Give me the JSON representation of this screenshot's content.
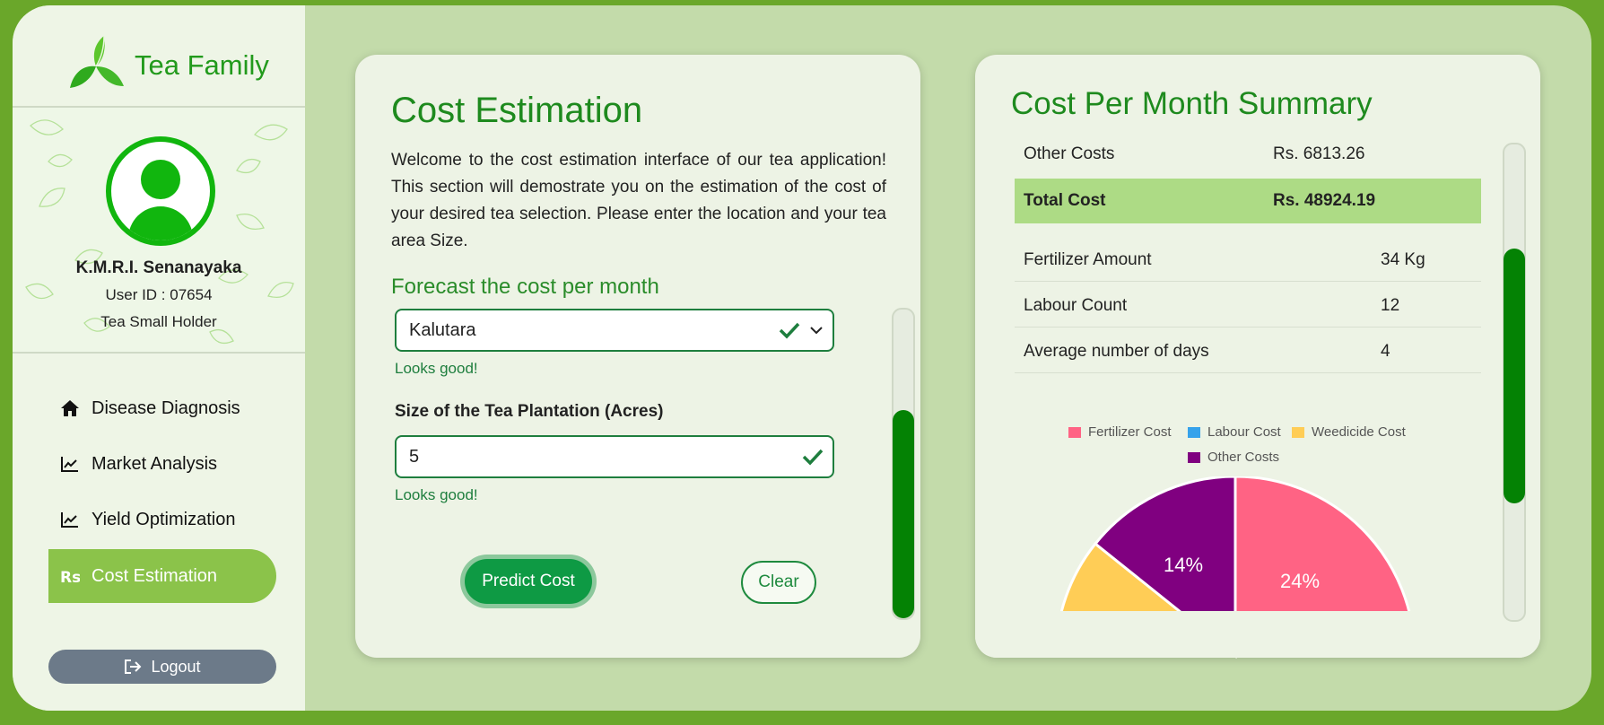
{
  "brand": {
    "name": "Tea Family"
  },
  "user": {
    "name": "K.M.R.I. Senanayaka",
    "id": "User ID : 07654",
    "role": "Tea Small Holder"
  },
  "nav": [
    {
      "label": "Disease Diagnosis",
      "icon": "home-icon"
    },
    {
      "label": "Market Analysis",
      "icon": "chart-line-icon"
    },
    {
      "label": "Yield Optimization",
      "icon": "chart-line-icon"
    },
    {
      "label": "Cost Estimation",
      "icon": "rupee-icon",
      "active": true
    }
  ],
  "logout": {
    "label": "Logout"
  },
  "estimation": {
    "title": "Cost Estimation",
    "intro": "Welcome to the cost estimation interface of our tea application! This section will demostrate you on the estimation of the cost of your desired tea selection. Please enter the location and your tea area Size.",
    "subtitle": "Forecast the cost per month",
    "location_value": "Kalutara",
    "location_feedback": "Looks good!",
    "size_label": "Size of the Tea Plantation (Acres)",
    "size_value": "5",
    "size_feedback": "Looks good!",
    "predict_label": "Predict Cost",
    "clear_label": "Clear",
    "scroll_position": 0.35
  },
  "summary": {
    "title": "Cost Per Month Summary",
    "cost_rows": [
      {
        "label": "Other Costs",
        "value": "Rs. 6813.26"
      },
      {
        "label": "Total Cost",
        "value": "Rs. 48924.19"
      }
    ],
    "detail_rows": [
      {
        "label": "Fertilizer Amount",
        "value": "34 Kg"
      },
      {
        "label": "Labour Count",
        "value": "12"
      },
      {
        "label": "Average number of days",
        "value": "4"
      }
    ]
  },
  "chart_data": {
    "type": "pie",
    "legend": [
      {
        "name": "Fertilizer Cost",
        "color": "#ff6384"
      },
      {
        "name": "Labour Cost",
        "color": "#36a2eb"
      },
      {
        "name": "Weedicide Cost",
        "color": "#ffcd56"
      },
      {
        "name": "Other Costs",
        "color": "#800080"
      }
    ],
    "visible_slices": [
      {
        "name": "Fertilizer Cost",
        "percent": 24,
        "color": "#ff6384"
      },
      {
        "name": "Weedicide Cost",
        "color": "#ffcd56"
      },
      {
        "name": "Other Costs",
        "percent": 14,
        "color": "#800080"
      }
    ],
    "labels": [
      "24%",
      "14%"
    ]
  },
  "colors": {
    "accent": "#1e8a1e",
    "active_nav": "#8bc34a",
    "scroll_thumb": "#048204"
  }
}
